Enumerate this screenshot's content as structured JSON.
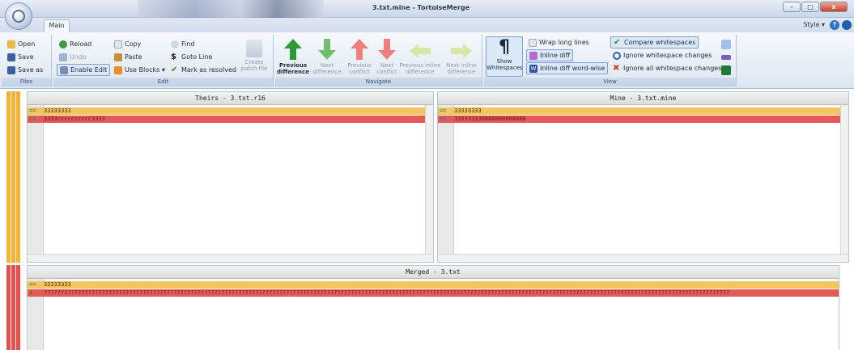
{
  "window": {
    "title": "3.txt.mine - TortoiseMerge",
    "controls": {
      "minimize": "–",
      "maximize": "□",
      "close": "x"
    }
  },
  "tabs": {
    "main": "Main"
  },
  "topright": {
    "style_menu": "Style ▾",
    "help": "?"
  },
  "ribbon": {
    "files": {
      "label": "Files",
      "open": "Open",
      "save": "Save",
      "save_as": "Save as"
    },
    "edit": {
      "label": "Edit",
      "reload": "Reload",
      "undo": "Undo",
      "enable_edit": "Enable Edit",
      "copy": "Copy",
      "paste": "Paste",
      "use_blocks": "Use Blocks ▾",
      "find": "Find",
      "goto_line": "Goto Line",
      "mark_resolved": "Mark as resolved",
      "create_patch_1": "Create",
      "create_patch_2": "patch file"
    },
    "navigate": {
      "label": "Navigate",
      "prev_diff_1": "Previous",
      "prev_diff_2": "difference",
      "next_diff_1": "Next",
      "next_diff_2": "difference",
      "prev_conflict_1": "Previous",
      "prev_conflict_2": "conflict",
      "next_conflict_1": "Next",
      "next_conflict_2": "conflict",
      "prev_inline_1": "Previous inline",
      "prev_inline_2": "difference",
      "next_inline_1": "Next inline",
      "next_inline_2": "difference"
    },
    "view": {
      "label": "View",
      "show_ws_1": "Show",
      "show_ws_2": "Whitespaces",
      "wrap_lines": "Wrap long lines",
      "inline_diff": "Inline diff",
      "inline_word": "Inline diff word-wise",
      "compare_ws": "Compare whitespaces",
      "ignore_ws_changes": "Ignore whitespace changes",
      "ignore_all_ws": "Ignore all whitespace changes"
    }
  },
  "panes": {
    "theirs": {
      "title": "Theirs - 3.txt.r16",
      "lines": [
        {
          "marker": "==",
          "text": "33333333"
        },
        {
          "marker": "+1",
          "text": "3333cccccccccc3333"
        }
      ]
    },
    "mine": {
      "title": "Mine - 3.txt.mine",
      "lines": [
        {
          "marker": "==",
          "text": "33333333"
        },
        {
          "marker": "+1",
          "text": "333333338888888888888"
        }
      ]
    },
    "merged": {
      "title": "Merged - 3.txt",
      "lines": [
        {
          "marker": "==",
          "text": "33333333"
        },
        {
          "marker": "1",
          "text": "?????????????????????????????????????????????????????????????????????????????????????????????????????????????????????????????????????????????????????????????????????????????????????????????????????????"
        }
      ]
    }
  },
  "colors": {
    "unchanged_line": "#f6c55f",
    "conflict_line": "#e45a5a",
    "accent_blue": "#2f6fc5"
  }
}
